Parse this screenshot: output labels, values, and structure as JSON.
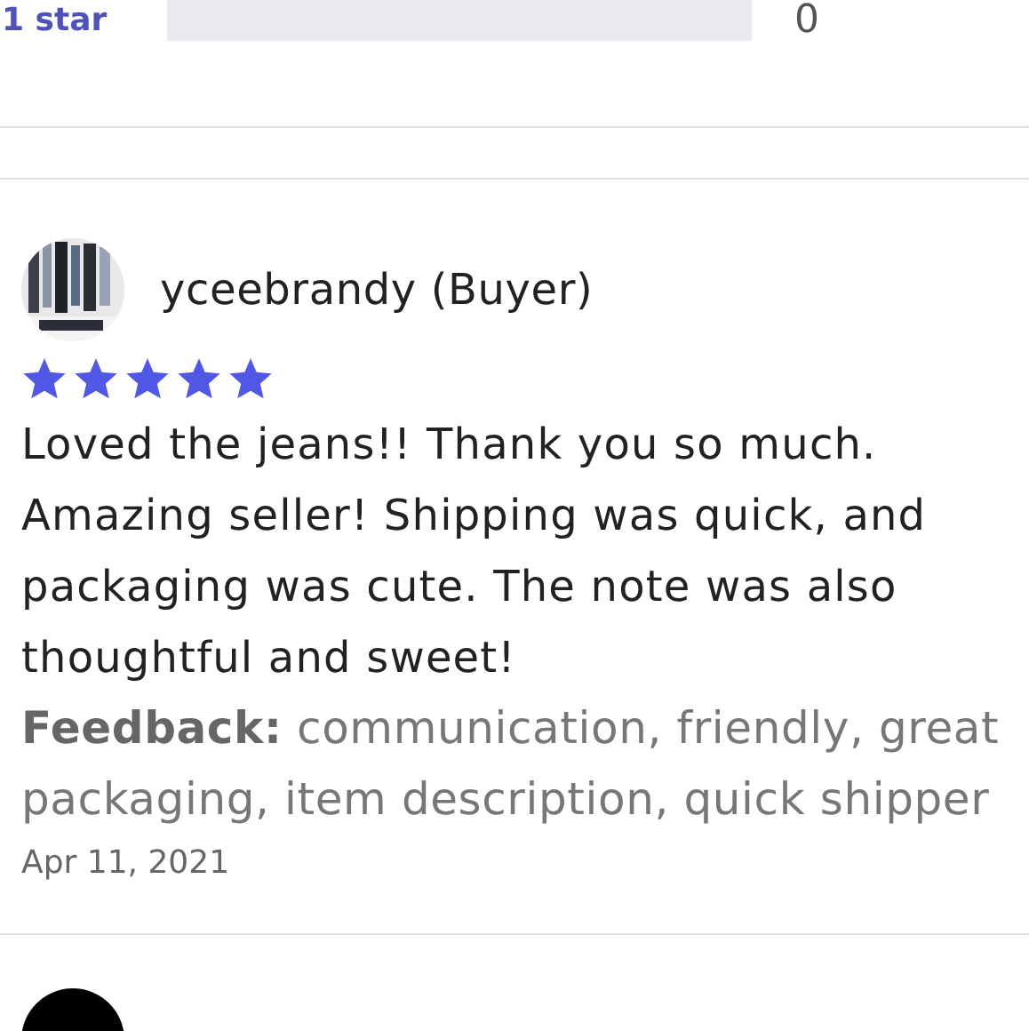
{
  "rating_breakdown": [
    {
      "label": "1 star",
      "level": 0,
      "count": "0"
    }
  ],
  "reviews": [
    {
      "kind": "full",
      "author": "yceebrandy (Buyer)",
      "stars": 5,
      "text": "Loved the jeans!! Thank you so much. Amazing seller! Shipping was quick, and packaging was cute. The note was also thoughtful and sweet!",
      "feedback_label": "Feedback:",
      "feedback": "communication, friendly, great packaging, item description, quick shipper",
      "date": "Apr 11, 2021"
    },
    {
      "kind": "cut"
    }
  ]
}
